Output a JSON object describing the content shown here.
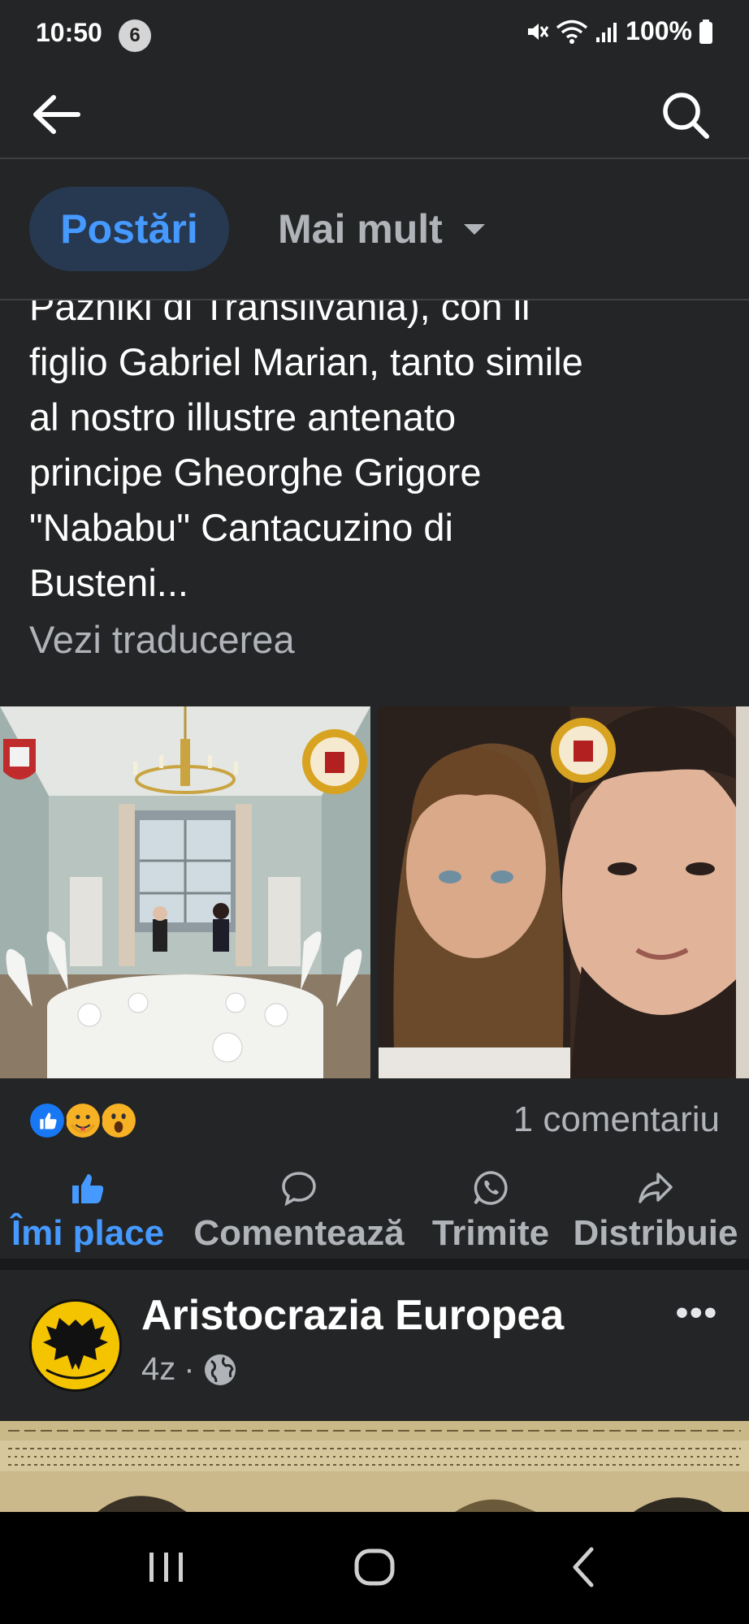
{
  "status_bar": {
    "time": "10:50",
    "notification_count": "6",
    "battery": "100%"
  },
  "tabs": {
    "posts": "Postări",
    "more": "Mai mult"
  },
  "post": {
    "text_lines": [
      "Pazniki di Transilvania), con il",
      "figlio Gabriel Marian, tanto simile",
      "al nostro illustre antenato",
      "principe Gheorghe Grigore",
      "\"Nababu\" Cantacuzino di",
      "Busteni..."
    ],
    "see_translation": "Vezi traducerea",
    "comment_count": "1 comentariu",
    "reactions": [
      "like-icon",
      "care-icon",
      "wow-icon"
    ]
  },
  "actions": {
    "like": "Îmi place",
    "comment": "Comentează",
    "send": "Trimite",
    "share": "Distribuie"
  },
  "post2": {
    "page_name": "Aristocrazia Europea",
    "time_ago": "4z",
    "separator": "·",
    "more": "•••"
  },
  "colors": {
    "background": "#242526",
    "accent": "#4599ff",
    "tab_active_bg": "#263951",
    "secondary_text": "#b0b3b8"
  }
}
